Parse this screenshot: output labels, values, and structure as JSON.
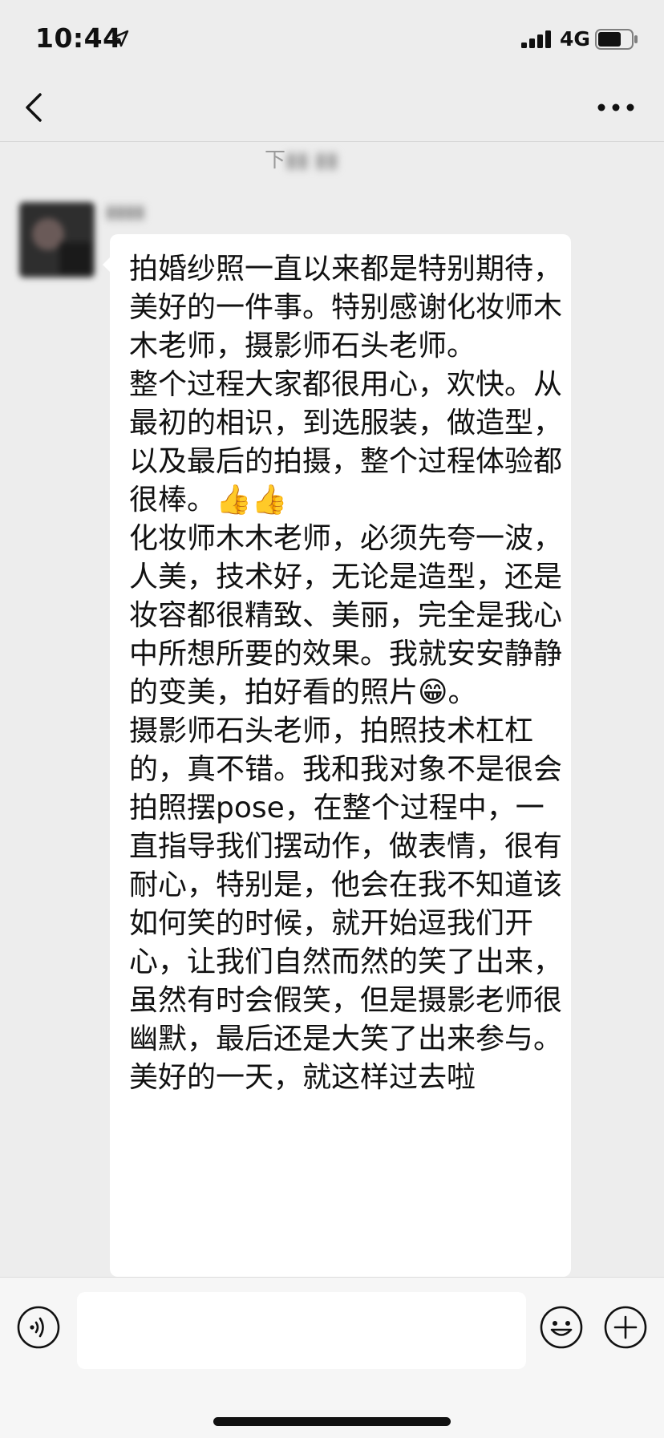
{
  "status_bar": {
    "time": "10:44",
    "network": "4G",
    "icons": [
      "location-arrow-icon",
      "signal-bars-icon",
      "battery-icon"
    ]
  },
  "nav": {
    "title": "",
    "icons": [
      "back-chevron-icon",
      "more-dots-icon"
    ]
  },
  "chat": {
    "timestamp_prefix": "下",
    "message": {
      "text": "拍婚纱照一直以来都是特别期待，美好的一件事。特别感谢化妆师木木老师，摄影师石头老师。\n整个过程大家都很用心，欢快。从最初的相识，到选服装，做造型，以及最后的拍摄，整个过程体验都很棒。👍👍\n化妆师木木老师，必须先夸一波，人美，技术好，无论是造型，还是妆容都很精致、美丽，完全是我心中所想所要的效果。我就安安静静的变美，拍好看的照片😁。\n摄影师石头老师，拍照技术杠杠的，真不错。我和我对象不是很会拍照摆pose，在整个过程中，一直指导我们摆动作，做表情，很有耐心，特别是，他会在我不知道该如何笑的时候，就开始逗我们开心，让我们自然而然的笑了出来，虽然有时会假笑，但是摄影老师很幽默，最后还是大笑了出来参与。\n美好的一天，就这样过去啦"
    }
  },
  "input_bar": {
    "text_value": "",
    "icons": [
      "voice-icon",
      "emoji-icon",
      "plus-icon"
    ]
  },
  "colors": {
    "background": "#ededed",
    "bubble": "#ffffff",
    "text": "#111111"
  }
}
